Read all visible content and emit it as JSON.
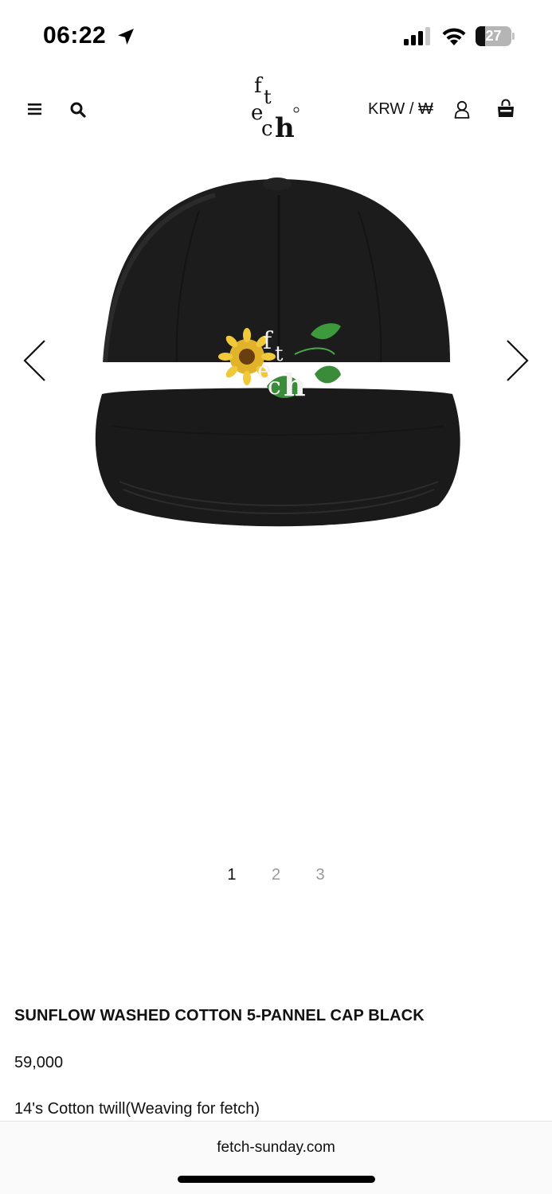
{
  "status_bar": {
    "time": "06:22",
    "battery_level": "27",
    "battery_fraction": 0.27
  },
  "header": {
    "logo_text": "fetch",
    "currency": "KRW / ₩",
    "icons": [
      "menu-icon",
      "search-icon",
      "user-icon",
      "shopping-bag-icon"
    ]
  },
  "carousel": {
    "pages": [
      "1",
      "2",
      "3"
    ],
    "active_page": 1,
    "icons": [
      "chevron-left-icon",
      "chevron-right-icon"
    ]
  },
  "product": {
    "title": "SUNFLOW WASHED COTTON 5-PANNEL CAP BLACK",
    "price": "59,000",
    "description": "14's Cotton twill(Weaving for fetch)",
    "embroidery_text": "fetch"
  },
  "browser": {
    "url": "fetch-sunday.com"
  }
}
